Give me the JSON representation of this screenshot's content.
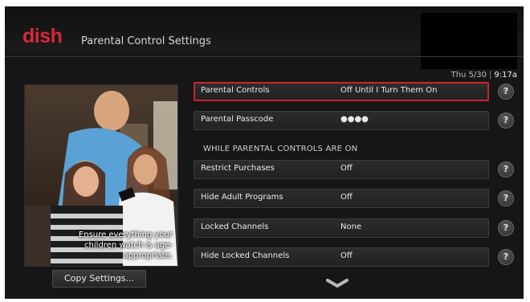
{
  "header": {
    "logo_text": "dish",
    "title": "Parental Control Settings"
  },
  "status": {
    "date": "Thu 5/30",
    "time": "9:17a"
  },
  "promo": {
    "caption": "Ensure everything your children watch is age-appropriate."
  },
  "copy_button_label": "Copy Settings...",
  "section_header": "WHILE PARENTAL CONTROLS ARE ON",
  "settings": [
    {
      "label": "Parental Controls",
      "value": "Off Until I Turn Them On",
      "selected": true
    },
    {
      "label": "Parental Passcode",
      "value": "●●●●",
      "selected": false
    },
    {
      "label": "Restrict Purchases",
      "value": "Off",
      "selected": false
    },
    {
      "label": "Hide Adult Programs",
      "value": "Off",
      "selected": false
    },
    {
      "label": "Locked Channels",
      "value": "None",
      "selected": false
    },
    {
      "label": "Hide Locked Channels",
      "value": "Off",
      "selected": false
    }
  ],
  "help_symbol": "?",
  "colors": {
    "brand_red": "#d7283a",
    "selection_border": "#c8252f",
    "background": "#161616"
  },
  "icons": {
    "help": "question-mark-icon",
    "scroll_down": "chevron-down-icon"
  }
}
